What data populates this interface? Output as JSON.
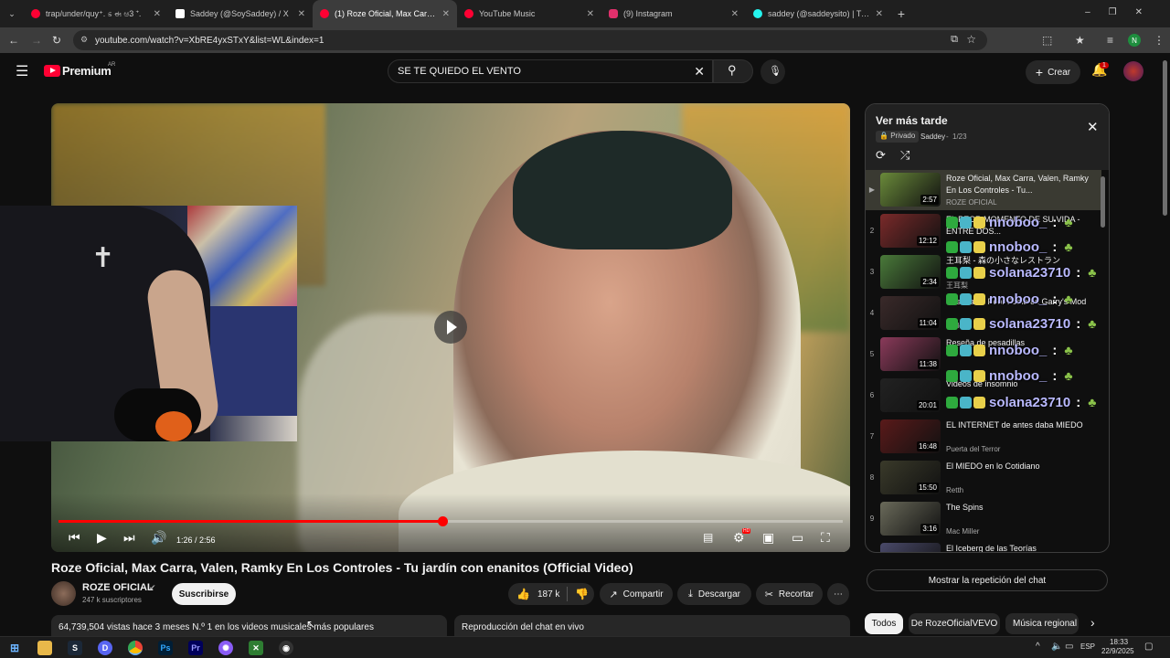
{
  "browser": {
    "tabs": [
      {
        "label": "trap/under/quy⁺. ಽ ಈ ಆ3 ⁺.",
        "color": "#ff0033"
      },
      {
        "label": "Saddey (@SoySaddey) / X",
        "color": "#ffffff"
      },
      {
        "label": "(1) Roze Oficial, Max Carra, Valen",
        "color": "#ff0033"
      },
      {
        "label": "YouTube Music",
        "color": "#ff0033"
      },
      {
        "label": "(9) Instagram",
        "color": "#e1306c"
      },
      {
        "label": "saddey (@saddeysito) | TikTok",
        "color": "#25f4ee"
      }
    ],
    "url": "youtube.com/watch?v=XbRE4yxSTxY&list=WL&index=1",
    "profile_initial": "N"
  },
  "header": {
    "logo_text": "Premium",
    "country": "AR",
    "search_value": "SE TE QUIEDO EL VENTO",
    "create_label": "Crear",
    "notif_count": "1"
  },
  "player": {
    "time": "1:26 / 2:56",
    "progress": 0.49,
    "settings_badge": "HD"
  },
  "video": {
    "title": "Roze Oficial, Max Carra, Valen, Ramky En Los Controles - Tu jardín con enanitos (Official Video)",
    "channel": "ROZE OFICIAL",
    "subscribers": "247 k suscriptores",
    "subscribe_label": "Suscribirse",
    "likes": "187 k",
    "share_label": "Compartir",
    "download_label": "Descargar",
    "clip_label": "Recortar",
    "views_line": "64,739,504 vistas  hace 3 meses  N.º 1 en los videos musicales más populares",
    "chat_replay_box": "Reproducción del chat en vivo"
  },
  "playlist": {
    "title": "Ver más tarde",
    "privacy": "Privado",
    "owner": "Saddey",
    "position": "1/23",
    "items": [
      {
        "num": "",
        "title": "Roze Oficial, Max Carra, Valen, Ramky En Los Controles - Tu...",
        "channel": "ROZE OFICIAL",
        "duration": "2:57",
        "thumb": "#6a8a3a"
      },
      {
        "num": "2",
        "title": "EL PEOR MOMENTO DE SU VIDA - ENTRE DOS...",
        "channel": "",
        "duration": "12:12",
        "thumb": "#7a2a2a"
      },
      {
        "num": "3",
        "title": "王耳梨 - 森の小さなレストラン",
        "channel": "王耳梨",
        "duration": "2:34",
        "thumb": "#4a7a3a"
      },
      {
        "num": "4",
        "title": "Reseña mi Peor Fobia en Garry's Mod",
        "channel": "Saddey",
        "duration": "11:04",
        "thumb": "#3a2a2a"
      },
      {
        "num": "5",
        "title": "Reseña de pesadillas",
        "channel": "",
        "duration": "11:38",
        "thumb": "#8a3a5a"
      },
      {
        "num": "6",
        "title": "Videos de insomnio",
        "channel": "",
        "duration": "20:01",
        "thumb": "#222222"
      },
      {
        "num": "7",
        "title": "EL INTERNET de antes daba MIEDO",
        "channel": "Puerta del Terror",
        "duration": "16:48",
        "thumb": "#5a1a1a"
      },
      {
        "num": "8",
        "title": "El MIEDO en lo Cotidiano",
        "channel": "Retth",
        "duration": "15:50",
        "thumb": "#3a3a2a"
      },
      {
        "num": "9",
        "title": "The Spins",
        "channel": "Mac Miller",
        "duration": "3:16",
        "thumb": "#6a6a5a"
      },
      {
        "num": "10",
        "title": "El Iceberg de las Teorías",
        "channel": "",
        "duration": "",
        "thumb": "#4a4a6a"
      }
    ]
  },
  "chat_overlay": [
    {
      "name": "nnoboo_",
      "suffix": ":",
      "color": "#b9b9ff"
    },
    {
      "name": "nnoboo_",
      "suffix": ":",
      "color": "#b9b9ff"
    },
    {
      "name": "solana23710",
      "suffix": ":",
      "color": "#b9b9ff"
    },
    {
      "name": "nnoboo_",
      "suffix": ":",
      "color": "#b9b9ff"
    },
    {
      "name": "solana23710",
      "suffix": ":",
      "color": "#b9b9ff"
    },
    {
      "name": "nnoboo_",
      "suffix": ":",
      "color": "#b9b9ff"
    },
    {
      "name": "nnoboo_",
      "suffix": ":",
      "color": "#b9b9ff"
    },
    {
      "name": "solana23710",
      "suffix": ":",
      "color": "#b9b9ff"
    }
  ],
  "sidebar_bottom": {
    "replay_label": "Mostrar la repetición del chat",
    "chips": [
      "Todos",
      "De RozeOficialVEVO",
      "Música regional"
    ]
  },
  "taskbar": {
    "lang": "ESP",
    "time": "18:33",
    "date": "22/9/2025"
  }
}
